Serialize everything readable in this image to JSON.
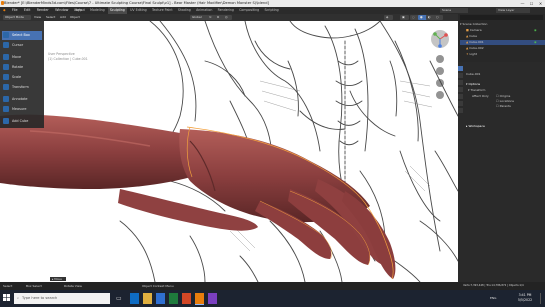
{
  "titlebar": {
    "title": "Blender* [E:\\BlenderMinds3d.com\\Files\\Course\\7 - Ultimate Sculpting Course\\Final Sculpt\\v1] - Bear Master (Hair Modifier\\Demon Monster S)\\blend]",
    "minimize": "—",
    "maximize": "☐",
    "close": "✕"
  },
  "menubar": {
    "menus": [
      "File",
      "Edit",
      "Render",
      "Window",
      "Help"
    ],
    "workspaces": [
      "Layout",
      "Modeling",
      "Sculpting",
      "UV Editing",
      "Texture Paint",
      "Shading",
      "Animation",
      "Rendering",
      "Compositing",
      "Scripting"
    ],
    "active_workspace": "Sculpting",
    "scene": "Scene",
    "view_layer": "View Layer"
  },
  "header": {
    "mode": "Object Mode",
    "view": "View",
    "select": "Select",
    "add": "Add",
    "object": "Object",
    "transform": "Global",
    "options": "Options"
  },
  "tools": [
    {
      "label": "Select Box",
      "icon": "select-box-icon",
      "active": true
    },
    {
      "label": "Cursor",
      "icon": "cursor-icon",
      "active": false
    },
    {
      "label": "Move",
      "icon": "move-icon",
      "active": false
    },
    {
      "label": "Rotate",
      "icon": "rotate-icon",
      "active": false
    },
    {
      "label": "Scale",
      "icon": "scale-icon",
      "active": false
    },
    {
      "label": "Transform",
      "icon": "transform-icon",
      "active": false
    },
    {
      "label": "Annotate",
      "icon": "annotate-icon",
      "active": false
    },
    {
      "label": "Measure",
      "icon": "measure-icon",
      "active": false
    },
    {
      "label": "Add Cube",
      "icon": "add-cube-icon",
      "active": false
    }
  ],
  "viewport_info": {
    "line1": "User Perspective",
    "line2": "(1) Collection | Cube.001"
  },
  "outliner": {
    "search_placeholder": "",
    "items": [
      {
        "label": "Scene Collection",
        "selected": false
      },
      {
        "label": "Camera",
        "selected": false
      },
      {
        "label": "Cube",
        "selected": false
      },
      {
        "label": "Cube.001",
        "selected": true
      },
      {
        "label": "Cube.002",
        "selected": false
      },
      {
        "label": "Light",
        "selected": false
      }
    ]
  },
  "properties": {
    "object_name": "Cube.001",
    "section_options": "Options",
    "section_transform": "Transform",
    "affect_only": "Affect Only",
    "opt_origins": "Origins",
    "opt_locations": "Locations",
    "opt_parents": "Parents",
    "section_workspace": "Workspace"
  },
  "statusbar": {
    "left_hint": "Select",
    "mid_hint": "Box Select",
    "rotate_hint": "Rotate View",
    "context_hint": "Object Context Menu",
    "stats": "Verts:7,393,448 | Tris:14,786,872 | Objects:1/4"
  },
  "taskbar": {
    "search_placeholder": "Type here to search",
    "time": "3:41 PM",
    "date": "5/5/2022",
    "lang": "ENG"
  },
  "colors": {
    "accent": "#4772b3",
    "skin": "#8b3f3f",
    "skin_highlight": "#b35e59",
    "outline": "#f2a03d",
    "viewport_bg": "#ffffff"
  }
}
